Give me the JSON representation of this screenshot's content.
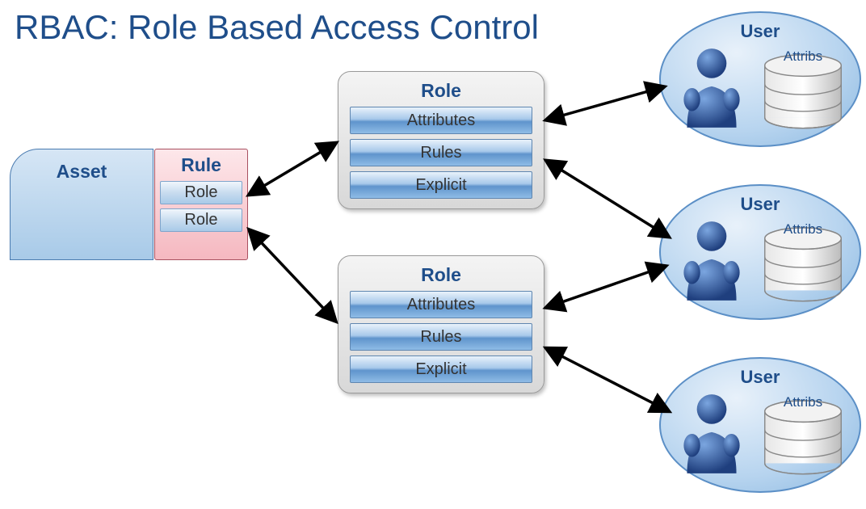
{
  "title": "RBAC: Role Based Access Control",
  "asset": {
    "label": "Asset"
  },
  "rule": {
    "label": "Rule",
    "roles": [
      "Role",
      "Role"
    ]
  },
  "roleCards": [
    {
      "title": "Role",
      "rows": [
        "Attributes",
        "Rules",
        "Explicit"
      ]
    },
    {
      "title": "Role",
      "rows": [
        "Attributes",
        "Rules",
        "Explicit"
      ]
    }
  ],
  "users": [
    {
      "label": "User",
      "attribs_label": "Attribs"
    },
    {
      "label": "User",
      "attribs_label": "Attribs"
    },
    {
      "label": "User",
      "attribs_label": "Attribs"
    }
  ]
}
